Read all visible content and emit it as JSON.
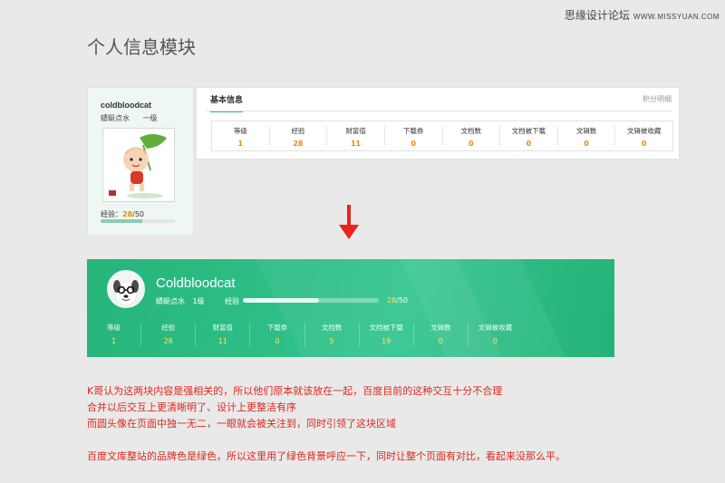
{
  "watermark": {
    "text": "思缘设计论坛",
    "url": "WWW.MISSYUAN.COM"
  },
  "page_title": "个人信息模块",
  "old_design": {
    "username": "coldbloodcat",
    "nickname": "蜻蜓点水",
    "level": "一级",
    "exp_label": "经验：",
    "exp_value": "28",
    "exp_max": "/50",
    "exp_progress": 0.56,
    "tab_title": "基本信息",
    "points_link": "积分明细",
    "stats": [
      {
        "label": "等级",
        "value": "1"
      },
      {
        "label": "经验",
        "value": "28"
      },
      {
        "label": "财富值",
        "value": "11"
      },
      {
        "label": "下载券",
        "value": "0"
      },
      {
        "label": "文档数",
        "value": "0"
      },
      {
        "label": "文档被下载",
        "value": "0"
      },
      {
        "label": "文辑数",
        "value": "0"
      },
      {
        "label": "文辑被收藏",
        "value": "0"
      }
    ]
  },
  "new_design": {
    "username": "Coldbloodcat",
    "nickname": "蜻蜓点水",
    "level": "1级",
    "exp_label": "经验",
    "exp_value": "28",
    "exp_max": "/50",
    "exp_progress": 0.56,
    "stats": [
      {
        "label": "等级",
        "value": "1"
      },
      {
        "label": "经验",
        "value": "28"
      },
      {
        "label": "财富值",
        "value": "11"
      },
      {
        "label": "下载券",
        "value": "0"
      },
      {
        "label": "文档数",
        "value": "5"
      },
      {
        "label": "文档被下载",
        "value": "19"
      },
      {
        "label": "文辑数",
        "value": "0"
      },
      {
        "label": "文辑被收藏",
        "value": "0"
      }
    ]
  },
  "notes": [
    "K哥认为这两块内容是强相关的，所以他们原本就该放在一起，百度目前的这种交互十分不合理",
    "合并以后交互上更清晰明了、设计上更整洁有序",
    "而圆头像在页面中独一无二，一眼就会被关注到，同时引领了这块区域",
    "",
    "百度文库整站的品牌色是绿色，所以这里用了绿色背景呼应一下，同时让整个页面有对比，看起来没那么平。"
  ],
  "colors": {
    "brand_green": "#2fc189",
    "highlight_orange": "#f08a00",
    "highlight_yellow": "#ffe45c",
    "note_red": "#e1271d",
    "arrow_red": "#e8241c"
  },
  "icons": {
    "arrow": "down-arrow-icon",
    "old_avatar": "cartoon-avatar",
    "new_avatar": "dog-avatar"
  }
}
